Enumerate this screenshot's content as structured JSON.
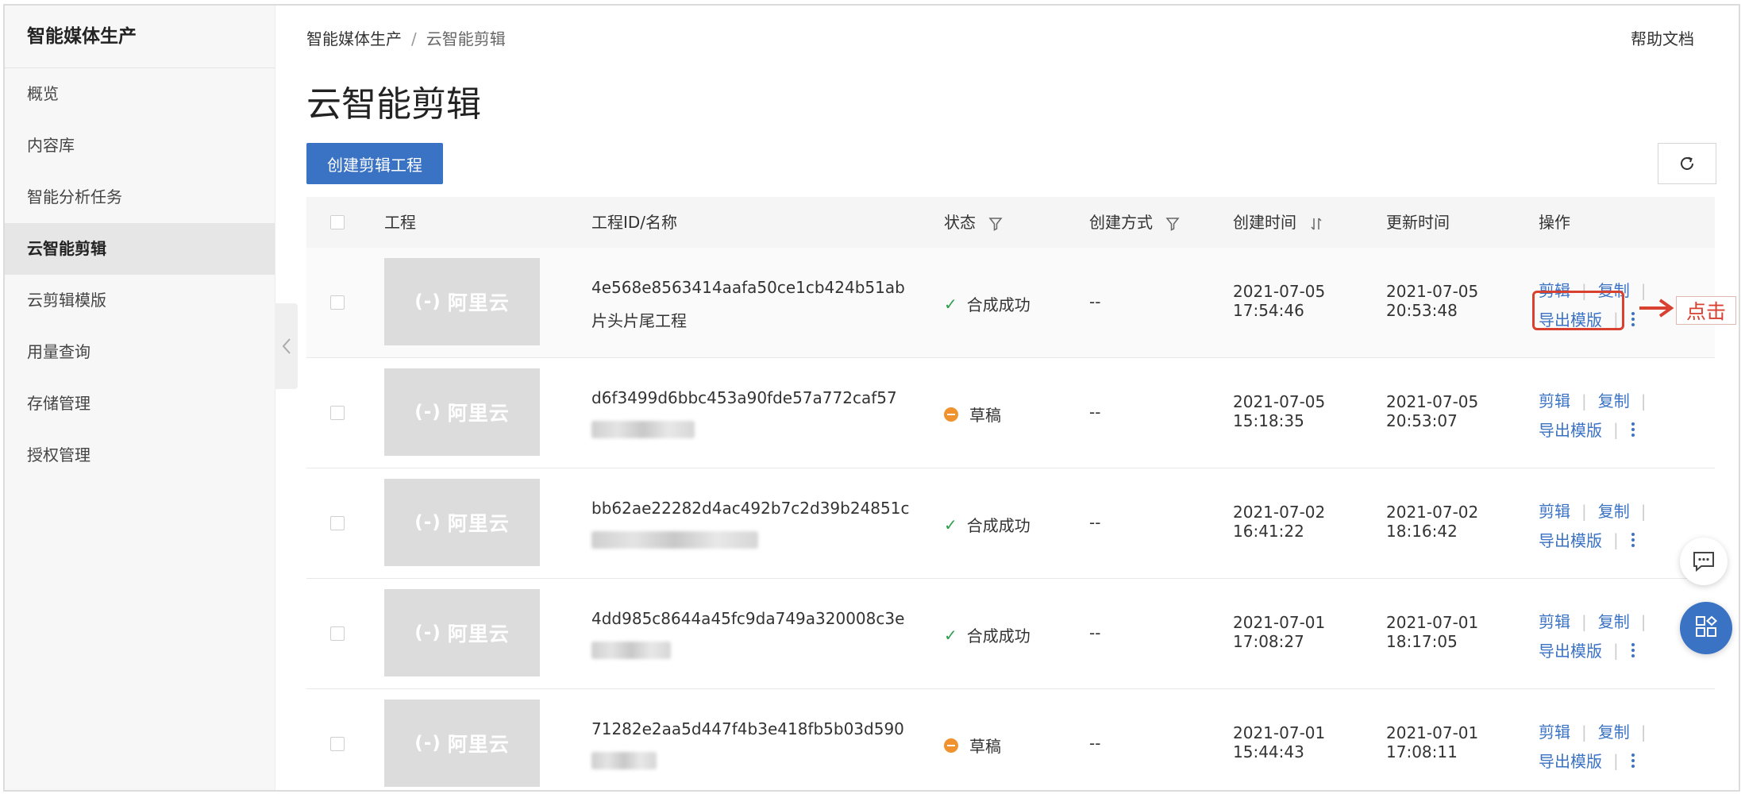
{
  "sidebar": {
    "title": "智能媒体生产",
    "items": [
      {
        "label": "概览",
        "active": false
      },
      {
        "label": "内容库",
        "active": false
      },
      {
        "label": "智能分析任务",
        "active": false
      },
      {
        "label": "云智能剪辑",
        "active": true
      },
      {
        "label": "云剪辑模版",
        "active": false
      },
      {
        "label": "用量查询",
        "active": false
      },
      {
        "label": "存储管理",
        "active": false
      },
      {
        "label": "授权管理",
        "active": false
      }
    ]
  },
  "breadcrumb": {
    "root": "智能媒体生产",
    "sep": "/",
    "current": "云智能剪辑"
  },
  "help_label": "帮助文档",
  "page_title": "云智能剪辑",
  "create_button": "创建剪辑工程",
  "table": {
    "columns": {
      "project": "工程",
      "id_name": "工程ID/名称",
      "status": "状态",
      "method": "创建方式",
      "created": "创建时间",
      "updated": "更新时间",
      "actions": "操作"
    },
    "thumb_text": "阿里云",
    "thumb_mark": "(-)",
    "rows": [
      {
        "id": "4e568e8563414aafa50ce1cb424b51ab",
        "name": "片头片尾工程",
        "status": "合成成功",
        "status_type": "success",
        "method": "--",
        "created_date": "2021-07-05",
        "created_time": "17:54:46",
        "updated_date": "2021-07-05",
        "updated_time": "20:53:48"
      },
      {
        "id": "d6f3499d6bbc453a90fde57a772caf57",
        "name": "",
        "status": "草稿",
        "status_type": "draft",
        "method": "--",
        "created_date": "2021-07-05",
        "created_time": "15:18:35",
        "updated_date": "2021-07-05",
        "updated_time": "20:53:07"
      },
      {
        "id": "bb62ae22282d4ac492b7c2d39b24851c",
        "name": "",
        "status": "合成成功",
        "status_type": "success",
        "method": "--",
        "created_date": "2021-07-02",
        "created_time": "16:41:22",
        "updated_date": "2021-07-02",
        "updated_time": "18:16:42"
      },
      {
        "id": "4dd985c8644a45fc9da749a320008c3e",
        "name": "",
        "status": "合成成功",
        "status_type": "success",
        "method": "--",
        "created_date": "2021-07-01",
        "created_time": "17:08:27",
        "updated_date": "2021-07-01",
        "updated_time": "18:17:05"
      },
      {
        "id": "71282e2aa5d447f4b3e418fb5b03d590",
        "name": "",
        "status": "草稿",
        "status_type": "draft",
        "method": "--",
        "created_date": "2021-07-01",
        "created_time": "15:44:43",
        "updated_date": "2021-07-01",
        "updated_time": "17:08:11"
      }
    ],
    "actions": {
      "edit": "剪辑",
      "copy": "复制",
      "export_template": "导出模版",
      "separator": "|"
    }
  },
  "annotation": {
    "label": "点击",
    "color": "#d8402f"
  },
  "colors": {
    "accent": "#3a72c4",
    "success": "#2e9e4f",
    "draft": "#f0922e"
  },
  "icons": {
    "sidebar_collapse": "chevron-left-icon",
    "refresh": "refresh-icon",
    "filter": "filter-icon",
    "sort": "sort-icon",
    "more": "more-vertical-icon",
    "chat": "chat-icon",
    "apps": "apps-icon"
  }
}
